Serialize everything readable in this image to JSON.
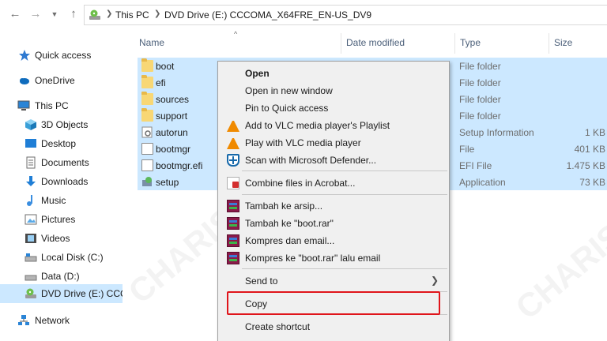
{
  "address_bar": {
    "breadcrumbs": [
      "This PC",
      "DVD Drive (E:) CCCOMA_X64FRE_EN-US_DV9"
    ],
    "icon": "dvd-drive-icon"
  },
  "columns": {
    "name": "Name",
    "date_modified": "Date modified",
    "type": "Type",
    "size": "Size"
  },
  "sidebar": {
    "items": [
      {
        "label": "Quick access",
        "icon": "star-icon"
      },
      {
        "label": "OneDrive",
        "icon": "cloud-icon"
      },
      {
        "label": "This PC",
        "icon": "computer-icon"
      },
      {
        "label": "3D Objects",
        "icon": "cube-icon"
      },
      {
        "label": "Desktop",
        "icon": "desktop-icon"
      },
      {
        "label": "Documents",
        "icon": "documents-icon"
      },
      {
        "label": "Downloads",
        "icon": "download-icon"
      },
      {
        "label": "Music",
        "icon": "music-icon"
      },
      {
        "label": "Pictures",
        "icon": "pictures-icon"
      },
      {
        "label": "Videos",
        "icon": "videos-icon"
      },
      {
        "label": "Local Disk (C:)",
        "icon": "disk-icon"
      },
      {
        "label": "Data (D:)",
        "icon": "disk-icon"
      },
      {
        "label": "DVD Drive (E:) CCCC",
        "icon": "dvd-drive-icon"
      },
      {
        "label": "Network",
        "icon": "network-icon"
      }
    ]
  },
  "files": [
    {
      "name": "boot",
      "type": "File folder",
      "size": "",
      "icon": "folder-icon"
    },
    {
      "name": "efi",
      "type": "File folder",
      "size": "",
      "icon": "folder-icon"
    },
    {
      "name": "sources",
      "type": "File folder",
      "size": "",
      "icon": "folder-icon"
    },
    {
      "name": "support",
      "type": "File folder",
      "size": "",
      "icon": "folder-icon"
    },
    {
      "name": "autorun",
      "type": "Setup Information",
      "size": "1 KB",
      "icon": "settings-file-icon"
    },
    {
      "name": "bootmgr",
      "type": "File",
      "size": "401 KB",
      "icon": "file-icon"
    },
    {
      "name": "bootmgr.efi",
      "type": "EFI File",
      "size": "1.475 KB",
      "icon": "file-icon"
    },
    {
      "name": "setup",
      "type": "Application",
      "size": "73 KB",
      "icon": "setup-app-icon"
    }
  ],
  "context_menu": {
    "items": [
      {
        "label": "Open"
      },
      {
        "label": "Open in new window"
      },
      {
        "label": "Pin to Quick access"
      },
      {
        "label": "Add to VLC media player's Playlist",
        "icon": "vlc-icon"
      },
      {
        "label": "Play with VLC media player",
        "icon": "vlc-icon"
      },
      {
        "label": "Scan with Microsoft Defender...",
        "icon": "defender-icon"
      },
      {
        "label": "Combine files in Acrobat...",
        "icon": "acrobat-icon"
      },
      {
        "label": "Tambah ke arsip...",
        "icon": "winrar-icon"
      },
      {
        "label": "Tambah ke \"boot.rar\"",
        "icon": "winrar-icon"
      },
      {
        "label": "Kompres dan email...",
        "icon": "winrar-icon"
      },
      {
        "label": "Kompres ke \"boot.rar\" lalu email",
        "icon": "winrar-icon"
      },
      {
        "label": "Send to"
      },
      {
        "label": "Copy"
      },
      {
        "label": "Create shortcut"
      }
    ]
  },
  "colors": {
    "selection": "#cce8ff",
    "highlight_box": "#e0151b",
    "menu_bg": "#f0f0f0"
  },
  "watermark": "CHARIS"
}
